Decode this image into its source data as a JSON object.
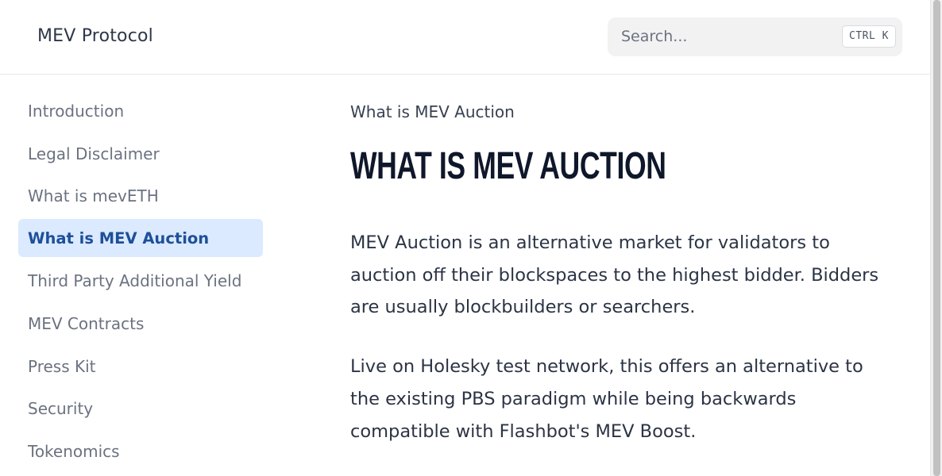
{
  "header": {
    "brand": "MEV Protocol",
    "search": {
      "placeholder": "Search...",
      "shortcut": "CTRL K"
    }
  },
  "sidebar": {
    "items": [
      {
        "label": "Introduction",
        "active": false
      },
      {
        "label": "Legal Disclaimer",
        "active": false
      },
      {
        "label": "What is mevETH",
        "active": false
      },
      {
        "label": "What is MEV Auction",
        "active": true
      },
      {
        "label": "Third Party Additional Yield",
        "active": false
      },
      {
        "label": "MEV Contracts",
        "active": false
      },
      {
        "label": "Press Kit",
        "active": false
      },
      {
        "label": "Security",
        "active": false
      },
      {
        "label": "Tokenomics",
        "active": false
      }
    ]
  },
  "main": {
    "breadcrumb": "What is MEV Auction",
    "title": "What is MEV Auction",
    "paragraphs": [
      "MEV Auction is an alternative market for validators to auction off their blockspaces to the highest bidder. Bidders are usually blockbuilders or searchers.",
      "Live on Holesky test network, this offers an alternative to the existing PBS paradigm while being backwards compatible with Flashbot's MEV Boost."
    ]
  },
  "colors": {
    "active_bg": "#dbeafe",
    "active_text": "#1e4f9a",
    "title": "#0f172a"
  }
}
